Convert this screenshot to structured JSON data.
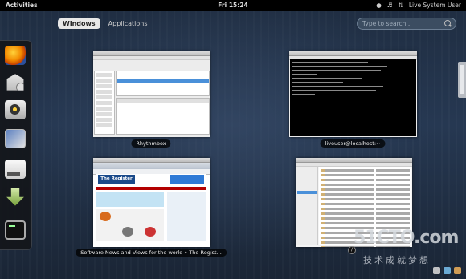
{
  "topbar": {
    "activities": "Activities",
    "clock": "Fri 15:24",
    "user": "Live System User"
  },
  "overview": {
    "tabs": [
      {
        "label": "Windows",
        "active": true
      },
      {
        "label": "Applications",
        "active": false
      }
    ],
    "search_placeholder": "Type to search..."
  },
  "dash": {
    "items": [
      "firefox-icon",
      "evolution-icon",
      "rhythmbox-icon",
      "shotwell-icon",
      "libreoffice-icon",
      "software-install-icon",
      "terminal-icon"
    ]
  },
  "windows": [
    {
      "title": "Rhythmbox"
    },
    {
      "title": "liveuser@localhost:~"
    },
    {
      "title": "Software News and Views for the world • The Regist..."
    },
    {
      "title": ""
    }
  ],
  "firefox_page": {
    "masthead": "The Register"
  },
  "watermark": {
    "primary": "51CTO.com",
    "secondary": "技术成就梦想"
  },
  "colors": {
    "topbar": "#000000",
    "accent": "#4a90d9",
    "background": "#263852"
  }
}
